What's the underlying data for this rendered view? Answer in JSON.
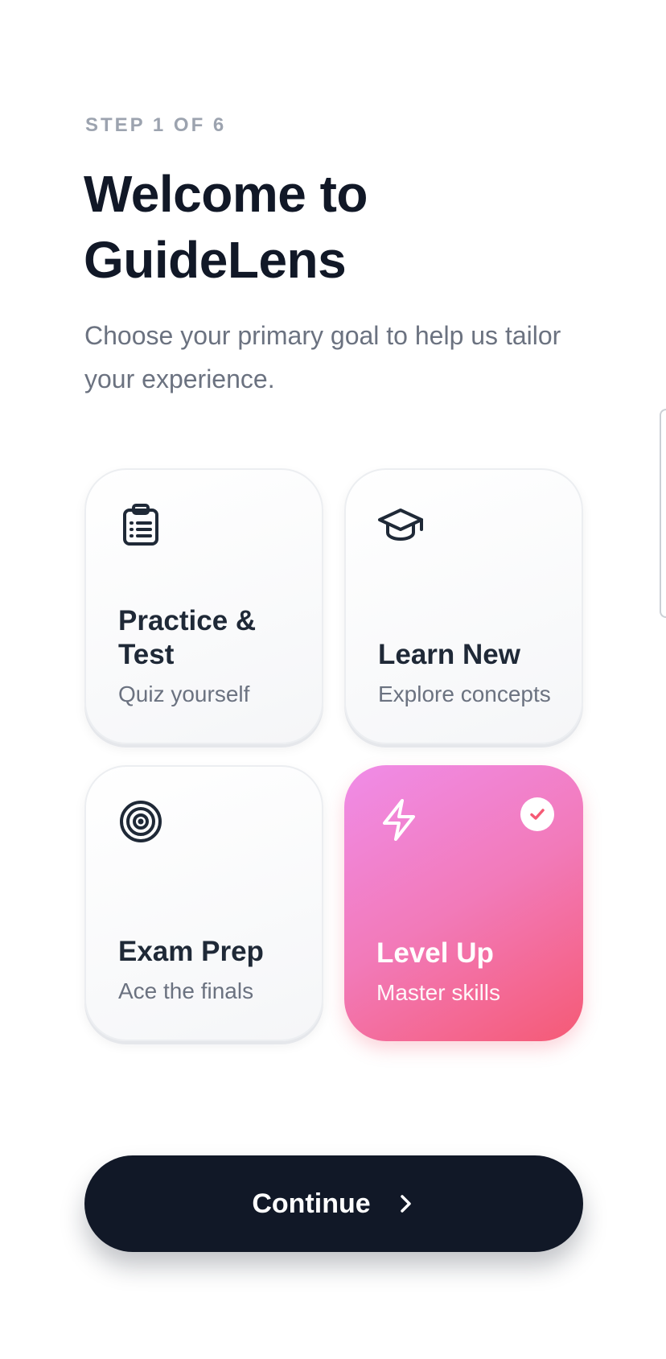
{
  "header": {
    "step": "STEP 1 OF 6",
    "title": "Welcome to GuideLens",
    "subtitle": "Choose your primary goal to help us tailor your experience."
  },
  "goals": [
    {
      "icon": "clipboard-list-icon",
      "title": "Practice & Test",
      "subtitle": "Quiz yourself",
      "selected": false
    },
    {
      "icon": "graduation-cap-icon",
      "title": "Learn New",
      "subtitle": "Explore concepts",
      "selected": false
    },
    {
      "icon": "target-icon",
      "title": "Exam Prep",
      "subtitle": "Ace the finals",
      "selected": false
    },
    {
      "icon": "lightning-bolt-icon",
      "title": "Level Up",
      "subtitle": "Master skills",
      "selected": true
    }
  ],
  "actions": {
    "continue_label": "Continue"
  },
  "colors": {
    "primary_dark": "#111827",
    "selected_gradient_start": "#f08ce8",
    "selected_gradient_end": "#f55a75",
    "muted_text": "#6b7280",
    "step_text": "#9ca3af"
  }
}
